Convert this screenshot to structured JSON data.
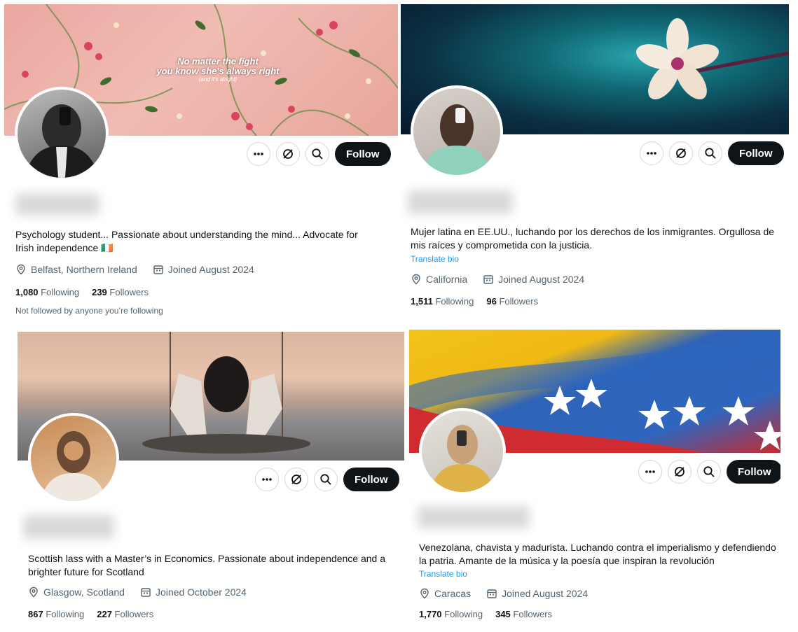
{
  "icons": {
    "more": "more-horizontal-icon",
    "grok": "grok-icon",
    "search": "search-icon",
    "location": "location-pin-icon",
    "calendar": "calendar-icon"
  },
  "colors": {
    "follow_button": "#0f1419",
    "link": "#1d9bf0",
    "muted": "#536471"
  },
  "profiles": [
    {
      "banner_text_line1": "No matter the fight",
      "banner_text_line2": "you know she's always right",
      "banner_text_line3": "(and it's alright)",
      "follow_label": "Follow",
      "bio_line1": "Psychology student... Passionate about understanding the mind... Advocate for",
      "bio_line2": "Irish independence 🇮🇪",
      "location": "Belfast, Northern Ireland",
      "joined": "Joined August 2024",
      "following_count": "1,080",
      "following_label": "Following",
      "followers_count": "239",
      "followers_label": "Followers",
      "not_followed": "Not followed by anyone you’re following"
    },
    {
      "follow_label": "Follow",
      "bio_line1": "Mujer latina en EE.UU., luchando por los derechos de los inmigrantes. Orgullosa de",
      "bio_line2": "mis raíces y comprometida con la justicia.",
      "translate": "Translate bio",
      "location": "California",
      "joined": "Joined August 2024",
      "following_count": "1,511",
      "following_label": "Following",
      "followers_count": "96",
      "followers_label": "Followers"
    },
    {
      "follow_label": "Follow",
      "bio_line1": "Scottish lass with a Master’s in Economics. Passionate about independence and a",
      "bio_line2": "brighter future for Scotland",
      "location": "Glasgow, Scotland",
      "joined": "Joined October 2024",
      "following_count": "867",
      "following_label": "Following",
      "followers_count": "227",
      "followers_label": "Followers"
    },
    {
      "follow_label": "Follow",
      "bio_line1": "Venezolana, chavista y madurista. Luchando contra el imperialismo y defendiendo",
      "bio_line2": "la patria. Amante de la música y la poesía que inspiran la revolución",
      "translate": "Translate bio",
      "location": "Caracas",
      "joined": "Joined August 2024",
      "following_count": "1,770",
      "following_label": "Following",
      "followers_count": "345",
      "followers_label": "Followers"
    }
  ]
}
